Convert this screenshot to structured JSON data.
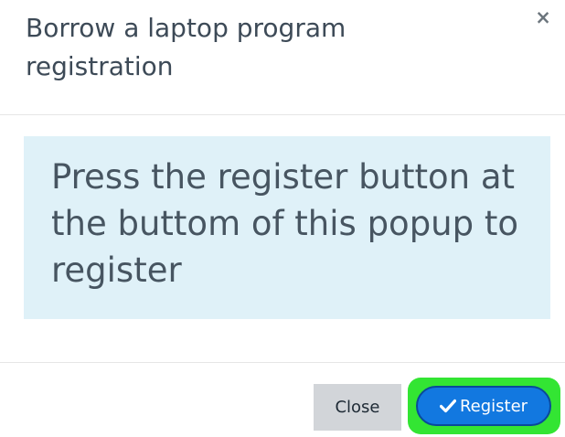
{
  "dialog": {
    "title": "Borrow a laptop program registration",
    "close_glyph": "×",
    "close_icon": "close-icon"
  },
  "body": {
    "message": "Press the register button at the buttom of this popup to register",
    "background_color": "#dff1f8"
  },
  "footer": {
    "close_label": "Close",
    "register_label": "Register",
    "register_icon": "check-icon",
    "register_color": "#1278e0",
    "highlight_color": "#33e533"
  }
}
